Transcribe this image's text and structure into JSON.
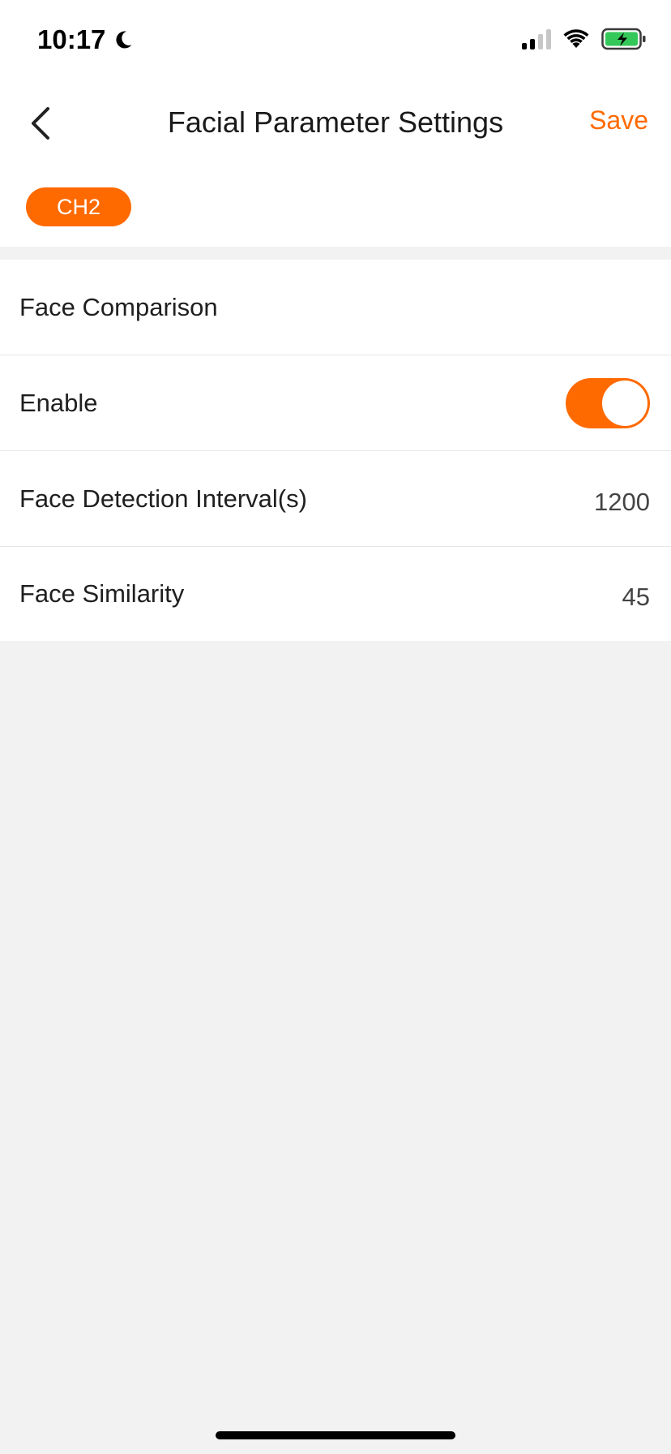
{
  "status_bar": {
    "time": "10:17",
    "icons": [
      "moon-icon",
      "signal-icon",
      "wifi-icon",
      "battery-icon"
    ]
  },
  "nav": {
    "title": "Facial Parameter Settings",
    "save_label": "Save",
    "back_icon": "chevron-left-icon"
  },
  "channel": {
    "label": "CH2"
  },
  "settings": {
    "section_title": "Face Comparison",
    "enable_label": "Enable",
    "enable_on": true,
    "interval_label": "Face Detection Interval(s)",
    "interval_value": "1200",
    "similarity_label": "Face Similarity",
    "similarity_value": "45"
  },
  "colors": {
    "accent": "#ff6a00",
    "background": "#f2f2f2",
    "surface": "#ffffff"
  }
}
